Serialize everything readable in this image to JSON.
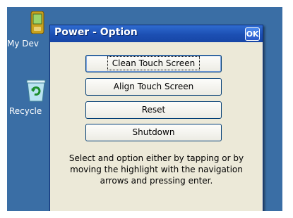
{
  "desktop": {
    "icons": [
      {
        "label": "My Dev",
        "icon": "handheld-device-icon"
      },
      {
        "label": "Recycle",
        "icon": "recycle-bin-icon"
      }
    ],
    "background_color": "#3a6ea5"
  },
  "dialog": {
    "title": "Power - Option",
    "ok_label": "OK",
    "buttons": [
      {
        "label": "Clean Touch Screen",
        "focused": true
      },
      {
        "label": "Align Touch Screen",
        "focused": false
      },
      {
        "label": "Reset",
        "focused": false
      },
      {
        "label": "Shutdown",
        "focused": false
      }
    ],
    "help_text": "Select and option either by tapping or by moving the highlight with the navigation arrows and pressing enter."
  }
}
